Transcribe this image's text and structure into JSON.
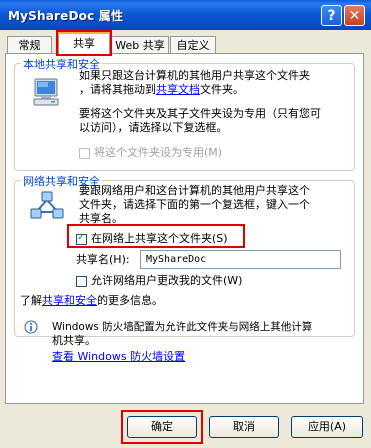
{
  "window": {
    "title": "MyShareDoc 属性",
    "help_label": "?",
    "close_label": "✕"
  },
  "tabs": [
    {
      "label": "常规"
    },
    {
      "label": "共享",
      "active": true
    },
    {
      "label": "Web 共享"
    },
    {
      "label": "自定义"
    }
  ],
  "local": {
    "title": "本地共享和安全",
    "line1": "如果只跟这台计算机的其他用户共享这个文件夹",
    "line2_pre": "，请将其拖动到",
    "line2_link": "共享文档",
    "line2_post": "文件夹。",
    "line3": "要将这个文件夹及其子文件夹设为专用（只有您可",
    "line4": "以访问），请选择以下复选框。",
    "private_checkbox": "将这个文件夹设为专用(M)",
    "private_checked": false
  },
  "network": {
    "title": "网络共享和安全",
    "line1": "要跟网络用户和这台计算机的其他用户共享这个",
    "line2": "文件夹，请选择下面的第一个复选框，键入一个",
    "line3": "共享名。",
    "share_checkbox": "在网络上共享这个文件夹(S)",
    "share_checked": true,
    "sharename_label": "共享名(H):",
    "sharename_value": "MyShareDoc",
    "allow_change_checkbox": "允许网络用户更改我的文件(W)",
    "allow_change_checked": false,
    "more_pre": "了解",
    "more_link": "共享和安全",
    "more_post": "的更多信息。"
  },
  "firewall": {
    "line1": "Windows 防火墙配置为允许此文件夹与网络上其他计算",
    "line2": "机共享。",
    "link": "查看 Windows 防火墙设置"
  },
  "buttons": {
    "ok": "确定",
    "cancel": "取消",
    "apply": "应用(A)"
  },
  "colors": {
    "titlebar": "#0a4ec8",
    "group_title": "#0046d5",
    "link": "#0000ff",
    "highlight": "#e00000"
  }
}
